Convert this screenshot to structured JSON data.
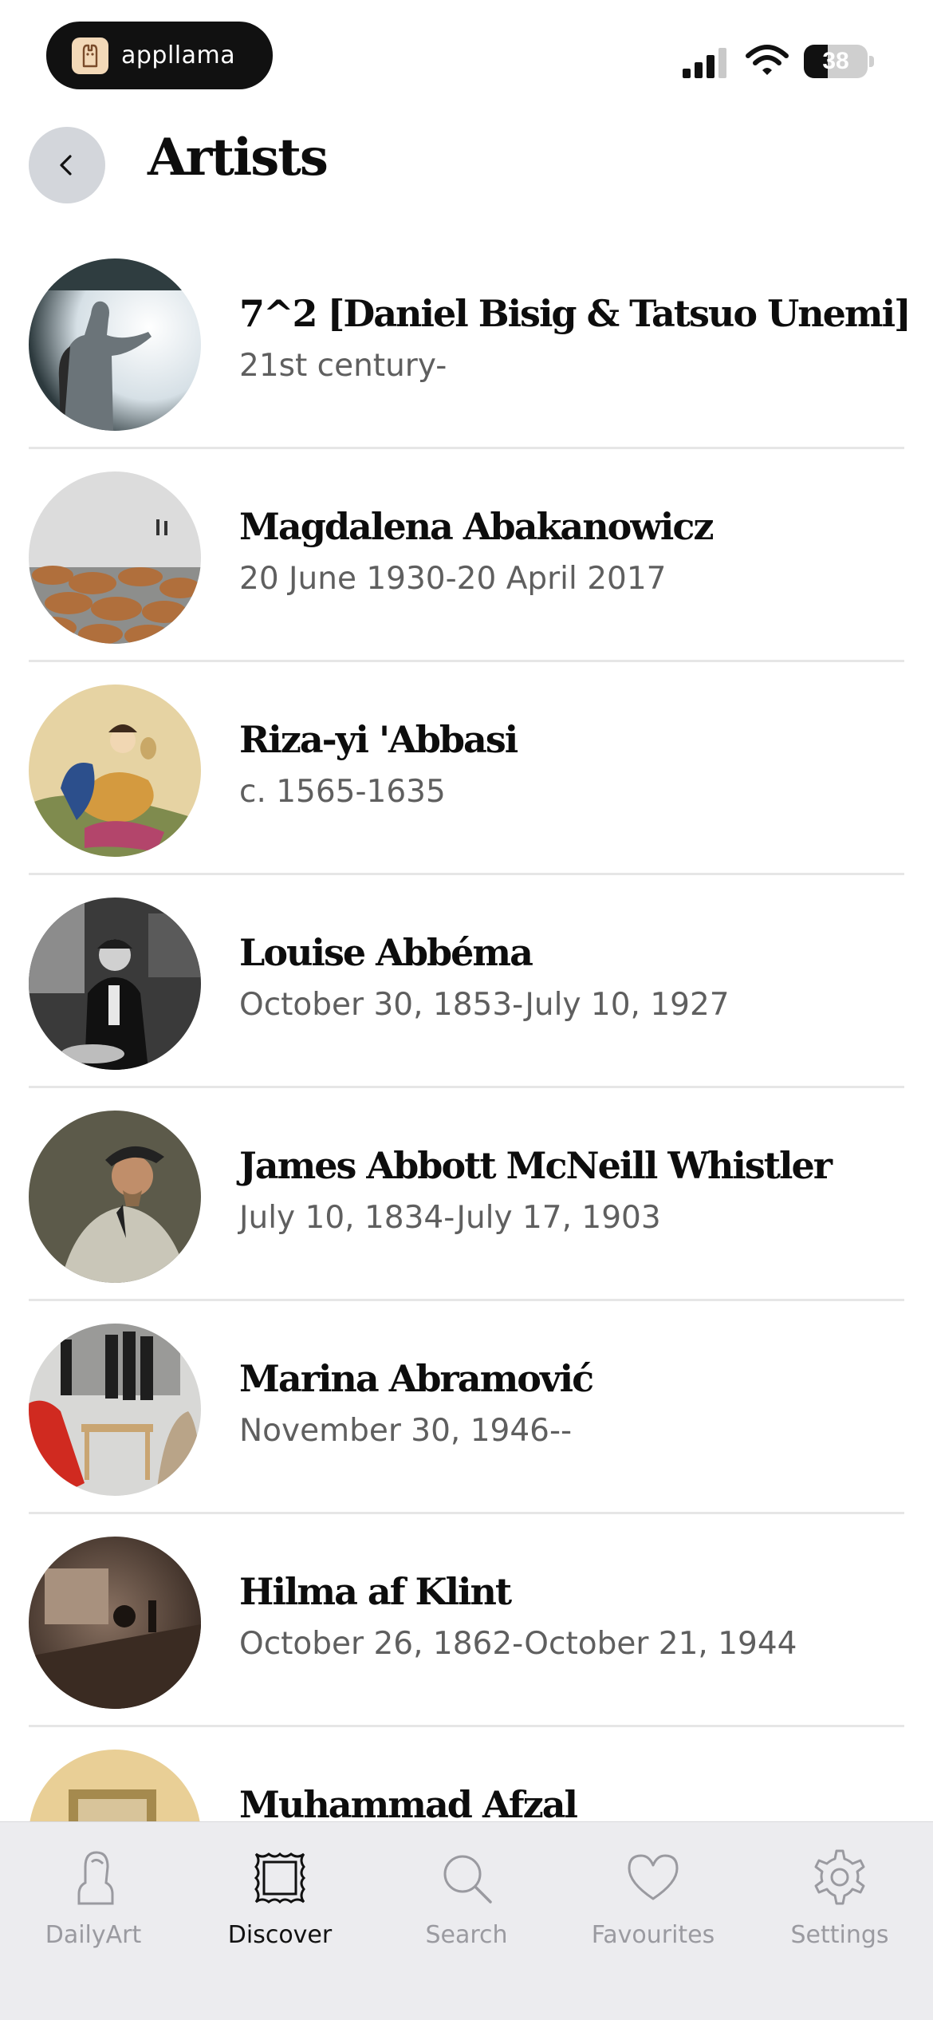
{
  "status_bar": {
    "app_name": "appllama",
    "battery_percent": 38,
    "battery_label": "38"
  },
  "header": {
    "title": "Artists",
    "back_icon": "chevron-left-icon"
  },
  "artists": [
    {
      "name": "7^2 [Daniel Bisig & Tatsuo Unemi]",
      "dates": "21st century-"
    },
    {
      "name": "Magdalena Abakanowicz",
      "dates": "20 June 1930-20 April 2017"
    },
    {
      "name": "Riza-yi 'Abbasi",
      "dates": "c. 1565-1635"
    },
    {
      "name": "Louise Abbéma",
      "dates": "October 30, 1853-July 10, 1927"
    },
    {
      "name": "James Abbott McNeill Whistler",
      "dates": "July 10, 1834-July 17, 1903"
    },
    {
      "name": "Marina Abramović",
      "dates": "November 30, 1946--"
    },
    {
      "name": "Hilma af Klint",
      "dates": "October 26, 1862-October 21, 1944"
    },
    {
      "name": "Muhammad Afzal",
      "dates": ""
    }
  ],
  "tab_bar": {
    "tabs": [
      {
        "label": "DailyArt",
        "icon": "bust-icon",
        "active": false
      },
      {
        "label": "Discover",
        "icon": "frame-icon",
        "active": true
      },
      {
        "label": "Search",
        "icon": "search-icon",
        "active": false
      },
      {
        "label": "Favourites",
        "icon": "heart-icon",
        "active": false
      },
      {
        "label": "Settings",
        "icon": "gear-icon",
        "active": false
      }
    ]
  },
  "colors": {
    "active_tab": "#111111",
    "inactive_tab": "#9a9aa0",
    "tab_bar_bg": "#ececef",
    "secondary_text": "#5f5f5f"
  }
}
